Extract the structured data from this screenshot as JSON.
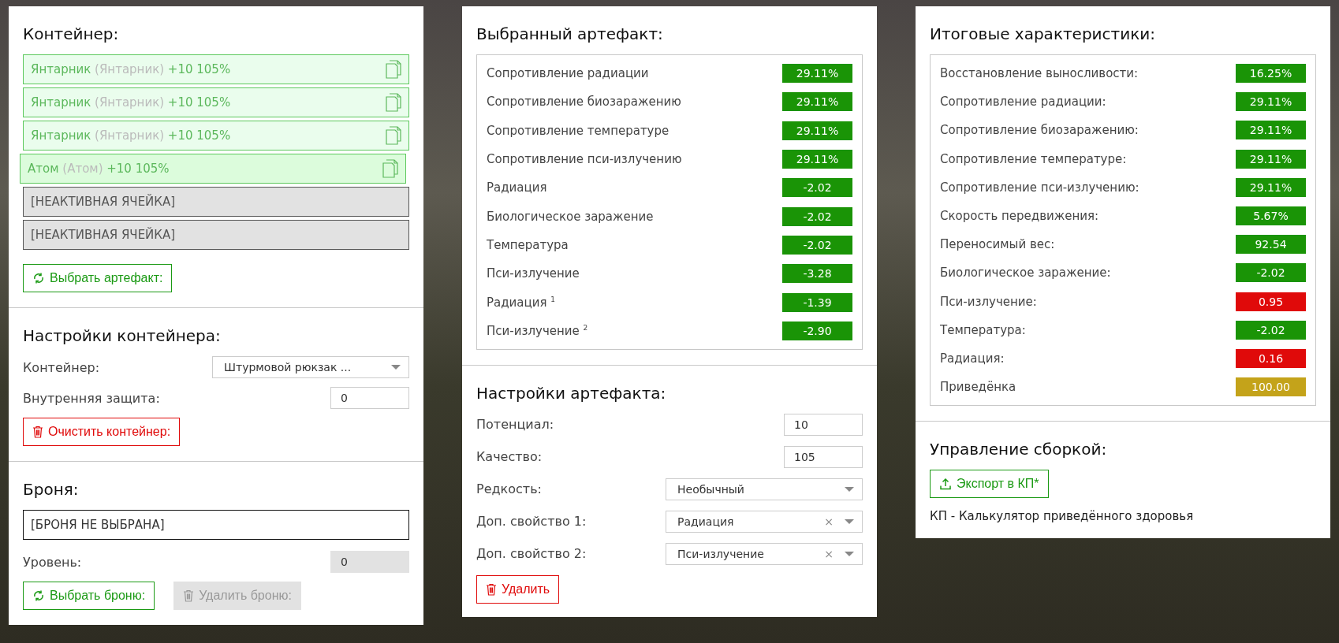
{
  "container": {
    "title": "Контейнер:",
    "slots": [
      {
        "kind": "artifact",
        "name": "Янтарник",
        "original": "(Янтарник)",
        "upgrade": "+10 105%",
        "selected": false
      },
      {
        "kind": "artifact",
        "name": "Янтарник",
        "original": "(Янтарник)",
        "upgrade": "+10 105%",
        "selected": false
      },
      {
        "kind": "artifact",
        "name": "Янтарник",
        "original": "(Янтарник)",
        "upgrade": "+10 105%",
        "selected": false
      },
      {
        "kind": "artifact",
        "name": "Атом",
        "original": "(Атом)",
        "upgrade": "+10 105%",
        "selected": true
      },
      {
        "kind": "inactive",
        "name": "[НЕАКТИВНАЯ ЯЧЕЙКА]",
        "selected": false
      },
      {
        "kind": "inactive",
        "name": "[НЕАКТИВНАЯ ЯЧЕЙКА]",
        "selected": false
      }
    ],
    "buttons": [
      {
        "label": "Выбрать артефакт:",
        "kind": "pick",
        "disabled": false
      }
    ]
  },
  "container_settings": {
    "title": "Настройки контейнера:",
    "fields": [
      {
        "kind": "select",
        "label": "Контейнер:",
        "value": "Штурмовой рюкзак ..."
      },
      {
        "kind": "input",
        "label": "Внутренняя защита:",
        "value": "0",
        "disabled": false
      }
    ],
    "buttons": [
      {
        "label": "Очистить контейнер:",
        "kind": "delete",
        "disabled": false
      }
    ]
  },
  "armor": {
    "title": "Броня:",
    "selection": "[БРОНЯ НЕ ВЫБРАНА]",
    "fields": [
      {
        "kind": "input",
        "label": "Уровень:",
        "value": "0",
        "disabled": true
      }
    ],
    "buttons": [
      {
        "label": "Выбрать броню:",
        "kind": "pick",
        "disabled": false
      },
      {
        "label": "Удалить броню:",
        "kind": "delete",
        "disabled": true
      }
    ]
  },
  "selected_artifact": {
    "title": "Выбранный артефакт:",
    "stats": [
      {
        "label": "Сопротивление радиации",
        "value": "29.11%",
        "color": "#1a9406"
      },
      {
        "label": "Сопротивление биозаражению",
        "value": "29.11%",
        "color": "#1a9406"
      },
      {
        "label": "Сопротивление температуре",
        "value": "29.11%",
        "color": "#1a9406"
      },
      {
        "label": "Сопротивление пси-излучению",
        "value": "29.11%",
        "color": "#1a9406"
      },
      {
        "label": "Радиация",
        "value": "-2.02",
        "color": "#1a9406"
      },
      {
        "label": "Биологическое заражение",
        "value": "-2.02",
        "color": "#1a9406"
      },
      {
        "label": "Температура",
        "value": "-2.02",
        "color": "#1a9406"
      },
      {
        "label": "Пси-излучение",
        "value": "-3.28",
        "color": "#1a9406"
      },
      {
        "label": "Радиация $^{1}$",
        "value": "-1.39",
        "color": "#1a9406"
      },
      {
        "label": "Пси-излучение $^{2}$",
        "value": "-2.90",
        "color": "#1a9406"
      }
    ]
  },
  "artifact_settings": {
    "title": "Настройки артефакта:",
    "fields": [
      {
        "kind": "input",
        "label": "Потенциал:",
        "value": "10",
        "disabled": false
      },
      {
        "kind": "input",
        "label": "Качество:",
        "value": "105",
        "disabled": false
      },
      {
        "kind": "select",
        "label": "Редкость:",
        "value": "Необычный"
      },
      {
        "kind": "select",
        "label": "Доп. свойство 1:",
        "value": "Радиация",
        "clear": "×"
      },
      {
        "kind": "select",
        "label": "Доп. свойство 2:",
        "value": "Пси-излучение",
        "clear": "×"
      }
    ],
    "buttons": [
      {
        "label": "Удалить",
        "kind": "delete",
        "disabled": false
      }
    ]
  },
  "totals": {
    "title": "Итоговые характеристики:",
    "stats": [
      {
        "label": "Восстановление выносливости:",
        "value": "16.25%",
        "color": "#1a9406"
      },
      {
        "label": "Сопротивление радиации:",
        "value": "29.11%",
        "color": "#1a9406"
      },
      {
        "label": "Сопротивление биозаражению:",
        "value": "29.11%",
        "color": "#1a9406"
      },
      {
        "label": "Сопротивление температуре:",
        "value": "29.11%",
        "color": "#1a9406"
      },
      {
        "label": "Сопротивление пси-излучению:",
        "value": "29.11%",
        "color": "#1a9406"
      },
      {
        "label": "Скорость передвижения:",
        "value": "5.67%",
        "color": "#1a9406"
      },
      {
        "label": "Переносимый вес:",
        "value": "92.54",
        "color": "#1a9406"
      },
      {
        "label": "Биологическое заражение:",
        "value": "-2.02",
        "color": "#1a9406"
      },
      {
        "label": "Пси-излучение:",
        "value": "0.95",
        "color": "#e00a0a"
      },
      {
        "label": "Температура:",
        "value": "-2.02",
        "color": "#1a9406"
      },
      {
        "label": "Радиация:",
        "value": "0.16",
        "color": "#e00a0a"
      },
      {
        "label": "Приведёнка",
        "value": "100.00",
        "color": "#c4a31a"
      }
    ]
  },
  "build": {
    "title": "Управление сборкой:",
    "buttons": [
      {
        "label": "Экспорт в КП*",
        "kind": "export",
        "disabled": false
      }
    ],
    "note": "КП - Калькулятор приведённого здоровья"
  }
}
